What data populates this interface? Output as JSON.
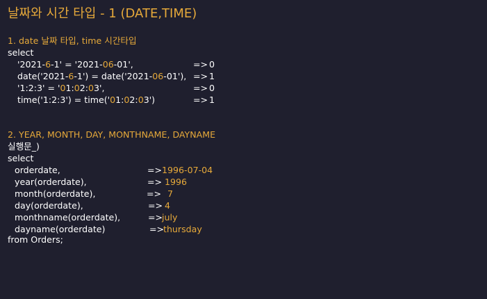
{
  "title": "날짜와 시간 타입 - 1 (DATE,TIME)",
  "section1": {
    "heading": "1. date 날짜 타입, time 시간타입",
    "select": "select",
    "rows": [
      {
        "parts": [
          {
            "t": "'2021-",
            "h": false
          },
          {
            "t": "6",
            "h": true
          },
          {
            "t": "-1' = '2021-",
            "h": false
          },
          {
            "t": "06",
            "h": true
          },
          {
            "t": "-01',",
            "h": false
          }
        ],
        "arrow": "=>",
        "result": "0"
      },
      {
        "parts": [
          {
            "t": "date('2021-",
            "h": false
          },
          {
            "t": "6",
            "h": true
          },
          {
            "t": "-1') = date('2021-",
            "h": false
          },
          {
            "t": "06",
            "h": true
          },
          {
            "t": "-01'),",
            "h": false
          }
        ],
        "arrow": "=>",
        "result": "1"
      },
      {
        "parts": [
          {
            "t": "'1:2:3' = '",
            "h": false
          },
          {
            "t": "0",
            "h": true
          },
          {
            "t": "1:",
            "h": false
          },
          {
            "t": "0",
            "h": true
          },
          {
            "t": "2:",
            "h": false
          },
          {
            "t": "0",
            "h": true
          },
          {
            "t": "3',",
            "h": false
          }
        ],
        "arrow": "=>",
        "result": "0"
      },
      {
        "parts": [
          {
            "t": "time('1:2:3') = time('",
            "h": false
          },
          {
            "t": "0",
            "h": true
          },
          {
            "t": "1:",
            "h": false
          },
          {
            "t": "0",
            "h": true
          },
          {
            "t": "2:",
            "h": false
          },
          {
            "t": "0",
            "h": true
          },
          {
            "t": "3')",
            "h": false
          }
        ],
        "arrow": "=>",
        "result": "1"
      }
    ]
  },
  "section2": {
    "heading": "2. YEAR, MONTH, DAY, MONTHNAME, DAYNAME",
    "subheading": "실행문_)",
    "select": "select",
    "rows": [
      {
        "expr": "orderdate,",
        "arrow": "=>",
        "result": "1996-07-04"
      },
      {
        "expr": "year(orderdate),",
        "arrow": "=>",
        "result": " 1996"
      },
      {
        "expr": "month(orderdate),",
        "arrow": "=>",
        "result": "  7"
      },
      {
        "expr": "day(orderdate),",
        "arrow": "=>",
        "result": " 4"
      },
      {
        "expr": "monthname(orderdate),",
        "arrow": "=>",
        "result": "july"
      },
      {
        "expr": "dayname(orderdate)",
        "arrow": "=>",
        "result": "thursday"
      }
    ],
    "from": "from Orders;"
  },
  "colors": {
    "background": "#1f1f2e",
    "accent": "#e6a93a",
    "text": "#ffffff"
  }
}
